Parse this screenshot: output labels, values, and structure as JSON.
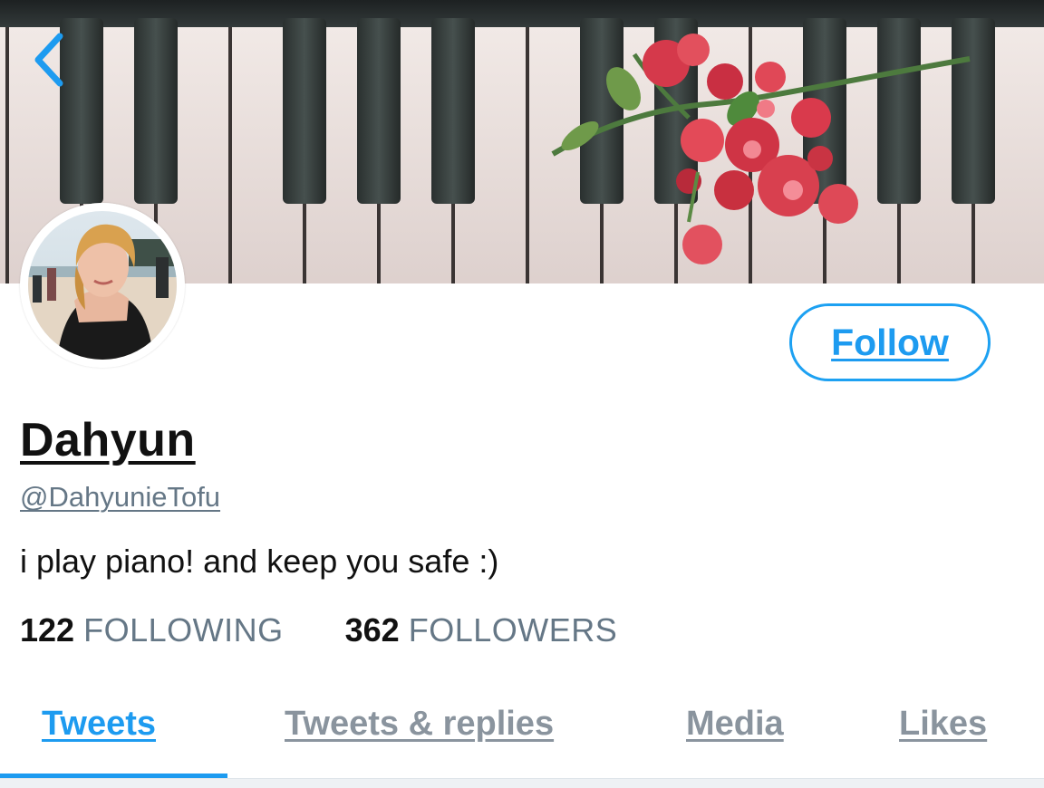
{
  "header": {
    "back_icon": "chevron-left-icon",
    "banner_image": "piano keys with red flowers",
    "accent_color": "#1d9bf0"
  },
  "profile": {
    "avatar_image": "profile photo on beach",
    "display_name": "Dahyun",
    "handle": "@DahyunieTofu",
    "bio": "i play piano! and keep you safe :)",
    "follow_label": "Follow"
  },
  "stats": {
    "following_count": "122",
    "following_label": "FOLLOWING",
    "followers_count": "362",
    "followers_label": "FOLLOWERS"
  },
  "tabs": [
    {
      "label": "Tweets",
      "active": true
    },
    {
      "label": "Tweets & replies",
      "active": false
    },
    {
      "label": "Media",
      "active": false
    },
    {
      "label": "Likes",
      "active": false
    }
  ]
}
